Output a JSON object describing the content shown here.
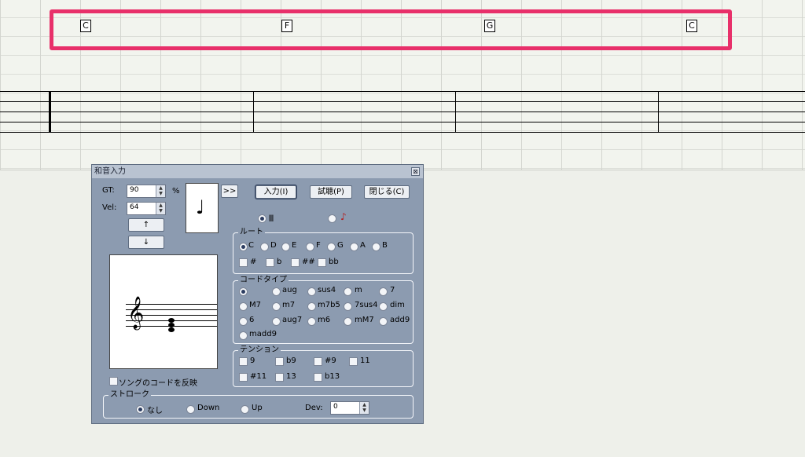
{
  "score": {
    "chords": [
      "C",
      "F",
      "G",
      "C"
    ]
  },
  "dialog": {
    "title": "和音入力",
    "close_glyph": "⊠",
    "gt_label": "GT:",
    "gt_value": "90",
    "vel_label": "Vel:",
    "vel_value": "64",
    "percent_label": "%",
    "up_arrow": "↑",
    "down_arrow": "↓",
    "expand_label": ">>",
    "input_button": "入力(I)",
    "preview_button": "試聴(P)",
    "close_button": "閉じる(C)",
    "note_glyph": "♩",
    "treble_glyph": "𝄞",
    "reflect_song_chords": "ソングのコードを反映",
    "root": {
      "caption": "ルート",
      "notes": [
        "C",
        "D",
        "E",
        "F",
        "G",
        "A",
        "B"
      ],
      "selected": "C",
      "accidentals": [
        "#",
        "b",
        "##",
        "bb"
      ]
    },
    "chord_type": {
      "caption": "コードタイプ",
      "rows": [
        [
          "",
          "aug",
          "sus4",
          "m",
          "7"
        ],
        [
          "M7",
          "m7",
          "m7b5",
          "7sus4",
          "dim"
        ],
        [
          "6",
          "aug7",
          "m6",
          "mM7",
          "add9"
        ],
        [
          "madd9"
        ]
      ],
      "selected": ""
    },
    "tension": {
      "caption": "テンション",
      "row1": [
        "9",
        "b9",
        "#9",
        "11"
      ],
      "row2": [
        "#11",
        "13",
        "b13"
      ]
    },
    "stroke": {
      "caption": "ストローク",
      "options": [
        "なし",
        "Down",
        "Up"
      ],
      "selected": "なし",
      "dev_label": "Dev:",
      "dev_value": "0"
    }
  },
  "colors": {
    "highlight": "#e8306a",
    "dialog_bg": "#8c9bb0"
  }
}
